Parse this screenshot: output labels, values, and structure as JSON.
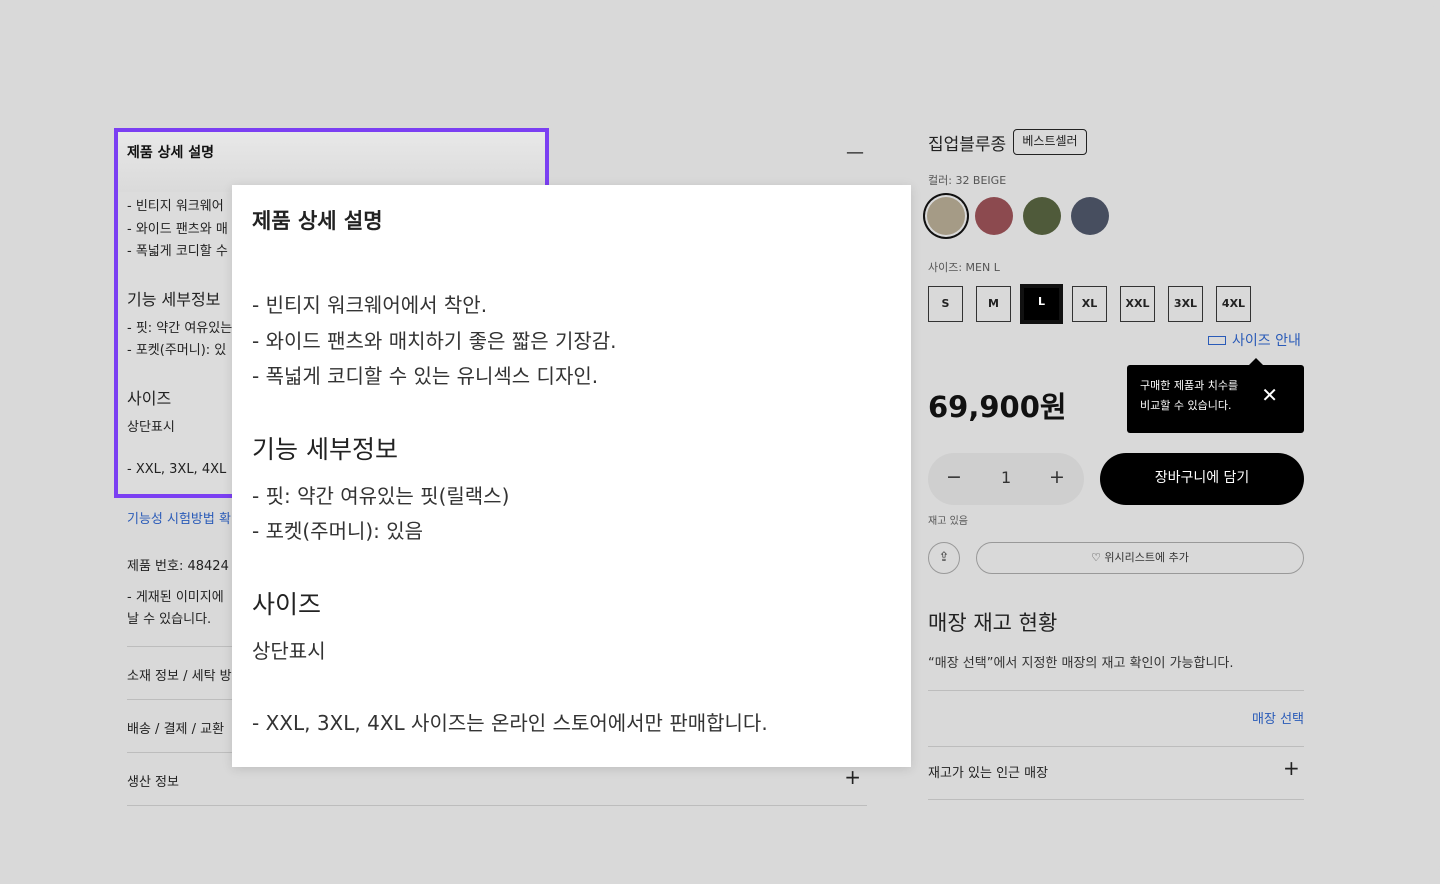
{
  "left": {
    "section_title": "제품 상세 설명",
    "collapse_icon": "minus-icon",
    "bullets": [
      "- 빈티지 워크웨어",
      "- 와이드 팬츠와 매",
      "- 폭넓게 코디할 수"
    ],
    "feature_heading": "기능 세부정보",
    "features": [
      "- 핏: 약간 여유있는",
      "- 포켓(주머니): 있"
    ],
    "size_heading": "사이즈",
    "size_sub": "상단표시",
    "size_note": "- XXL, 3XL, 4XL",
    "test_link": "기능성 시험방법 확",
    "product_no": "제품 번호: 48424",
    "image_note_1": "- 게재된 이미지에",
    "image_note_2": "날 수 있습니다.",
    "accordions": [
      "소재 정보 / 세탁 방",
      "배송 / 결제 / 교환",
      "생산 정보"
    ]
  },
  "zoom": {
    "title": "제품 상세 설명",
    "bullets": [
      "- 빈티지 워크웨어에서 착안.",
      "- 와이드 팬츠와 매치하기 좋은 짧은 기장감.",
      "- 폭넓게 코디할 수 있는 유니섹스 디자인."
    ],
    "feature_heading": "기능 세부정보",
    "features": [
      "- 핏: 약간 여유있는 핏(릴랙스)",
      "- 포켓(주머니): 있음"
    ],
    "size_heading": "사이즈",
    "size_sub": "상단표시",
    "size_note": "- XXL, 3XL, 4XL 사이즈는 온라인 스토어에서만 판매합니다."
  },
  "product": {
    "title": "집업블루종",
    "badge": "베스트셀러",
    "color_label": "컬러: 32 BEIGE",
    "colors": [
      "#a59b86",
      "#8c4a4f",
      "#4f5a3a",
      "#474e5f"
    ],
    "size_label": "사이즈: MEN L",
    "sizes": [
      "S",
      "M",
      "L",
      "XL",
      "XXL",
      "3XL",
      "4XL"
    ],
    "selected_size": "L",
    "size_guide": "사이즈 안내",
    "tooltip_line1": "구매한 제품과 치수를",
    "tooltip_line2": "비교할 수 있습니다.",
    "price": "69,900원",
    "qty_minus": "−",
    "qty": "1",
    "qty_plus": "+",
    "cart": "장바구니에 담기",
    "stock": "재고 있음",
    "wishlist": "♡ 위시리스트에 추가"
  },
  "store": {
    "heading": "매장 재고 현황",
    "desc": "“매장 선택”에서 지정한 매장의 재고 확인이 가능합니다.",
    "select": "매장 선택",
    "nearby": "재고가 있는 인근 매장",
    "plus": "+"
  }
}
